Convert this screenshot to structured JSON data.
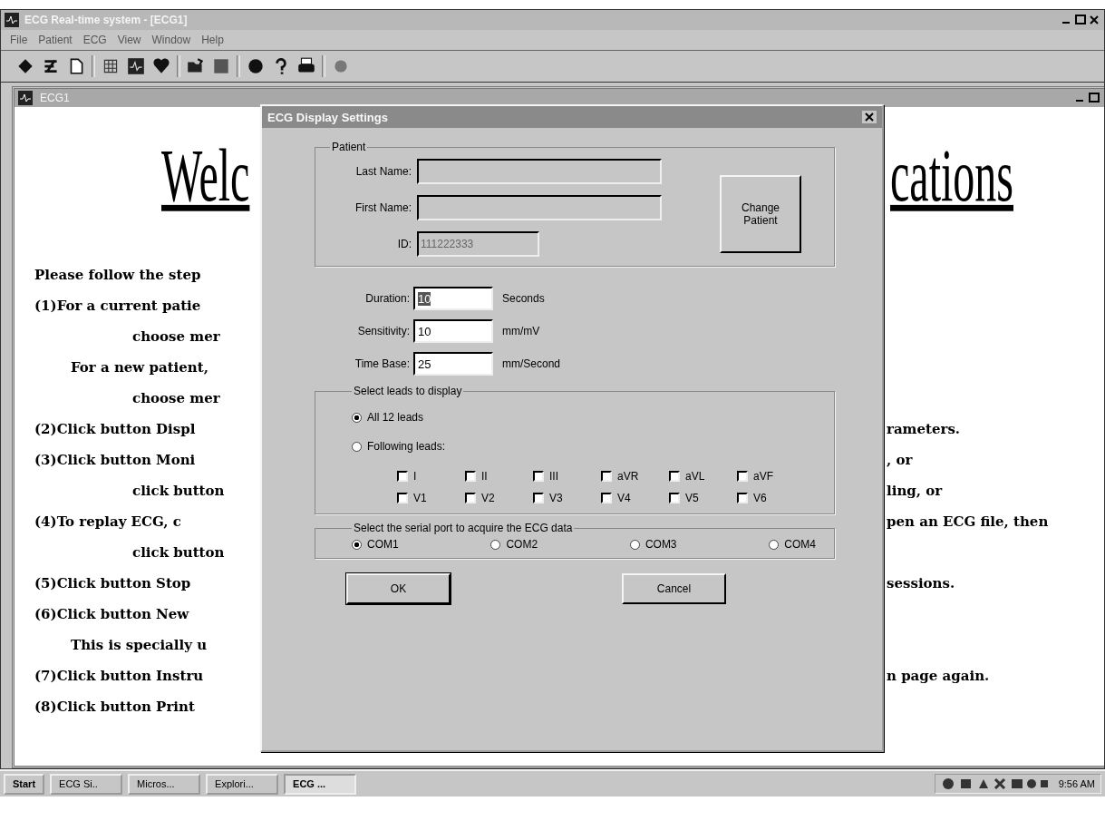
{
  "app": {
    "title": "ECG Real-time system - [ECG1]",
    "menu": [
      "File",
      "Patient",
      "ECG",
      "View",
      "Window",
      "Help"
    ]
  },
  "child_window": {
    "title": "ECG1"
  },
  "document": {
    "heading_left": "Welc",
    "heading_right": "cations",
    "lines": [
      {
        "kind": "step",
        "left": "Please follow the step"
      },
      {
        "kind": "step",
        "left": "(1)For a current patie"
      },
      {
        "kind": "sub",
        "left": "choose mer"
      },
      {
        "kind": "alt",
        "left": "For a new patient,"
      },
      {
        "kind": "sub",
        "left": "choose mer"
      },
      {
        "kind": "step",
        "left": "(2)Click button Displ",
        "right": "rameters."
      },
      {
        "kind": "step",
        "left": "(3)Click button Moni",
        "right": ", or"
      },
      {
        "kind": "sub",
        "left": "click button",
        "right": "ling, or"
      },
      {
        "kind": "step",
        "left": "(4)To replay ECG, c",
        "right": "pen an ECG file, then"
      },
      {
        "kind": "sub",
        "left": "click button"
      },
      {
        "kind": "step",
        "left": "(5)Click button Stop",
        "right": "sessions."
      },
      {
        "kind": "step",
        "left": "(6)Click button New"
      },
      {
        "kind": "alt",
        "left": "This is specially u"
      },
      {
        "kind": "step",
        "left": "(7)Click button Instru",
        "right": "n page again."
      },
      {
        "kind": "step",
        "left": "(8)Click button Print"
      }
    ]
  },
  "dialog": {
    "title": "ECG Display Settings",
    "patient": {
      "label": "Patient",
      "fields": [
        {
          "label": "Last Name:",
          "disabled": true
        },
        {
          "label": "First Name:",
          "disabled": true
        },
        {
          "label": "ID:",
          "value": "111222333",
          "disabled": true
        }
      ],
      "button": "Change Patient"
    },
    "settings": [
      {
        "label": "Duration:",
        "value": "10",
        "unit": "Seconds",
        "selected": true
      },
      {
        "label": "Sensitivity:",
        "value": "10",
        "unit": "mm/mV",
        "selected": false
      },
      {
        "label": "Time Base:",
        "value": "25",
        "unit": "mm/Second",
        "selected": false
      }
    ],
    "leads": {
      "label": "Select leads to display",
      "options": [
        {
          "label": "All 12 leads",
          "selected": true
        },
        {
          "label": "Following leads:",
          "selected": false
        }
      ],
      "checkboxes": [
        {
          "label": "I",
          "checked": false
        },
        {
          "label": "II",
          "checked": false
        },
        {
          "label": "III",
          "checked": false
        },
        {
          "label": "aVR",
          "checked": false
        },
        {
          "label": "aVL",
          "checked": false
        },
        {
          "label": "aVF",
          "checked": false
        },
        {
          "label": "V1",
          "checked": false
        },
        {
          "label": "V2",
          "checked": false
        },
        {
          "label": "V3",
          "checked": false
        },
        {
          "label": "V4",
          "checked": false
        },
        {
          "label": "V5",
          "checked": false
        },
        {
          "label": "V6",
          "checked": false
        }
      ]
    },
    "port": {
      "label": "Select the serial port to acquire the ECG data",
      "options": [
        {
          "label": "COM1",
          "selected": true
        },
        {
          "label": "COM2",
          "selected": false
        },
        {
          "label": "COM3",
          "selected": false
        },
        {
          "label": "COM4",
          "selected": false
        }
      ]
    },
    "buttons": [
      "OK",
      "Cancel"
    ]
  },
  "taskbar": {
    "start": "Start",
    "tasks": [
      {
        "label": "ECG Si..",
        "selected": false
      },
      {
        "label": "Micros...",
        "selected": false
      },
      {
        "label": "Explori...",
        "selected": false
      },
      {
        "label": "ECG ...",
        "selected": true
      }
    ],
    "clock": "9:56 AM"
  }
}
